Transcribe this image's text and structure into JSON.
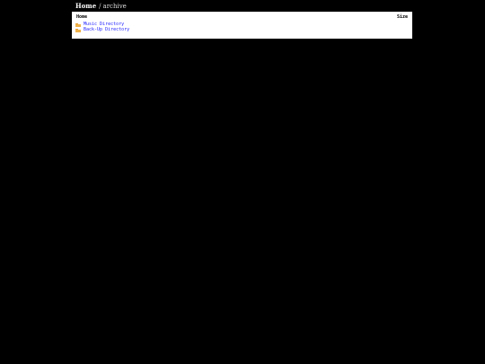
{
  "breadcrumb": {
    "home": "Home",
    "separator": "/",
    "current": "archive"
  },
  "listing": {
    "headers": {
      "name": "Home",
      "size": "Size"
    },
    "rows": [
      {
        "icon": "folder-icon",
        "label": "Music Directory",
        "size": ""
      },
      {
        "icon": "folder-icon",
        "label": "Back-Up Directory",
        "size": ""
      }
    ]
  },
  "colors": {
    "background": "#000000",
    "panel": "#ffffff",
    "link": "#1a1aff",
    "folder": "#f0b24a"
  }
}
